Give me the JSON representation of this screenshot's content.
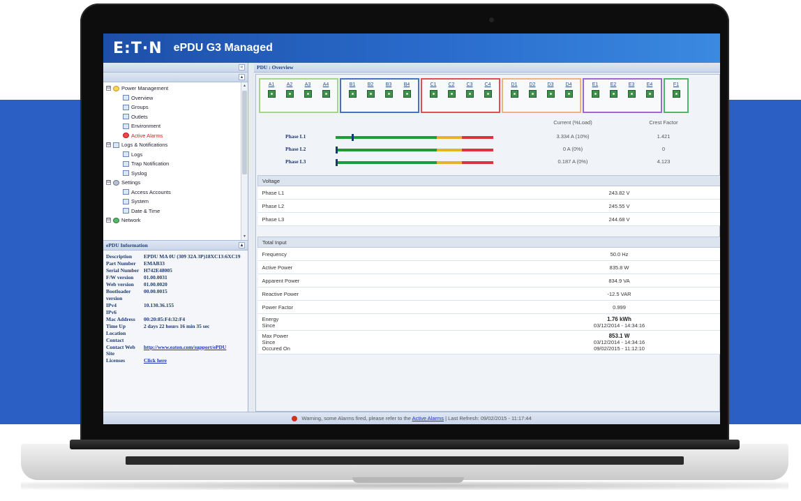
{
  "app": {
    "logo": "E:T·N",
    "product": "ePDU G3 Managed"
  },
  "colors": {
    "brand_blue": "#2a6ccc",
    "background_blue": "#2c5fc4",
    "alarm_red": "#d0211f",
    "bar_green": "#1e9b3b",
    "bar_yellow": "#e3b32a",
    "bar_red": "#d9343f"
  },
  "nav": {
    "items": [
      {
        "label": "Power Management",
        "icon": "power-management-icon",
        "level": 1,
        "expander": "⊟"
      },
      {
        "label": "Overview",
        "icon": "page-icon",
        "level": 2
      },
      {
        "label": "Groups",
        "icon": "page-icon",
        "level": 2
      },
      {
        "label": "Outlets",
        "icon": "page-icon",
        "level": 2
      },
      {
        "label": "Environment",
        "icon": "page-icon",
        "level": 2
      },
      {
        "label": "Active Alarms",
        "icon": "alarm-icon",
        "level": 2,
        "alarm": true
      },
      {
        "label": "Logs & Notifications",
        "icon": "page-icon",
        "level": 1,
        "expander": "⊟"
      },
      {
        "label": "Logs",
        "icon": "page-icon",
        "level": 2
      },
      {
        "label": "Trap Notification",
        "icon": "page-icon",
        "level": 2
      },
      {
        "label": "Syslog",
        "icon": "page-icon",
        "level": 2
      },
      {
        "label": "Settings",
        "icon": "settings-gear-icon",
        "level": 1,
        "expander": "⊟"
      },
      {
        "label": "Access Accounts",
        "icon": "page-icon",
        "level": 2
      },
      {
        "label": "System",
        "icon": "page-icon",
        "level": 2
      },
      {
        "label": "Date & Time",
        "icon": "page-icon",
        "level": 2
      },
      {
        "label": "Network",
        "icon": "network-globe-icon",
        "level": 1,
        "expander": "⊟"
      }
    ]
  },
  "info_panel": {
    "title": "ePDU Information",
    "rows": [
      {
        "k": "Description",
        "v": "EPDU MA 0U (309 32A 3P)18XC13:6XC19"
      },
      {
        "k": "Part Number",
        "v": "EMAB33"
      },
      {
        "k": "Serial Number",
        "v": "H742E48005"
      },
      {
        "k": "F/W version",
        "v": "01.00.0031"
      },
      {
        "k": "Web version",
        "v": "01.00.0020"
      },
      {
        "k": "Bootloader version",
        "v": "00.00.0015"
      },
      {
        "k": "IPv4",
        "v": "10.130.36.155"
      },
      {
        "k": "IPv6",
        "v": ""
      },
      {
        "k": "Mac Address",
        "v": "00:20:85:F4:32:F4"
      },
      {
        "k": "Time Up",
        "v": "2 days 22 hours 16 min 35 sec"
      },
      {
        "k": "Location",
        "v": ""
      },
      {
        "k": "Contact",
        "v": ""
      },
      {
        "k": "Contact Web Site",
        "v": "http://www.eaton.com/support/ePDU",
        "link": true
      },
      {
        "k": "Licenses",
        "v": "Click here",
        "link": true
      }
    ]
  },
  "breadcrumb": "PDU : Overview",
  "outlet_groups": [
    {
      "color": "#a7d48a",
      "outlets": [
        "A1",
        "A2",
        "A3",
        "A4"
      ]
    },
    {
      "color": "#4a6fc4",
      "outlets": [
        "B1",
        "B2",
        "B3",
        "B4"
      ]
    },
    {
      "color": "#e04d56",
      "outlets": [
        "C1",
        "C2",
        "C3",
        "C4"
      ]
    },
    {
      "color": "#f2b37a",
      "outlets": [
        "D1",
        "D2",
        "D3",
        "D4"
      ]
    },
    {
      "color": "#9b6ad1",
      "outlets": [
        "E1",
        "E2",
        "E3",
        "E4"
      ]
    },
    {
      "color": "#4db86b",
      "outlets": [
        "F1"
      ]
    }
  ],
  "phases": {
    "col_current": "Current (%Load)",
    "col_crest": "Crest Factor",
    "rows": [
      {
        "name": "Phase L1",
        "current": "3.334 A (10%)",
        "load": 0.1,
        "crest": "1.421"
      },
      {
        "name": "Phase L2",
        "current": "0 A (0%)",
        "load": 0.0,
        "crest": "0"
      },
      {
        "name": "Phase L3",
        "current": "0.187 A (0%)",
        "load": 0.0,
        "crest": "4.123"
      }
    ]
  },
  "voltage": {
    "header": "Voltage",
    "rows": [
      {
        "label": "Phase L1",
        "value": "243.82 V"
      },
      {
        "label": "Phase L2",
        "value": "245.55 V"
      },
      {
        "label": "Phase L3",
        "value": "244.68 V"
      }
    ]
  },
  "total_input": {
    "header": "Total Input",
    "frequency": {
      "label": "Frequency",
      "value": "50.0 Hz"
    },
    "active_power": {
      "label": "Active Power",
      "value": "835.8 W"
    },
    "apparent_power": {
      "label": "Apparent Power",
      "value": "834.9 VA"
    },
    "reactive_power": {
      "label": "Reactive Power",
      "value": "-12.5 VAR"
    },
    "power_factor": {
      "label": "Power Factor",
      "value": "0.999"
    },
    "energy": {
      "label": "Energy",
      "since_label": "Since",
      "value": "1.76 kWh",
      "since": "03/12/2014 - 14:34:16"
    },
    "max_power": {
      "label": "Max Power",
      "since_label": "Since",
      "occured_label": "Occured On",
      "value": "853.1 W",
      "since": "03/12/2014 - 14:34:16",
      "occured": "09/02/2015 - 11:12:10"
    }
  },
  "status": {
    "prefix": "Warning, some Alarms fired, please refer to the",
    "link": "Active Alarms",
    "suffix": "| Last Refresh: 09/02/2015 - 11:17:44"
  }
}
